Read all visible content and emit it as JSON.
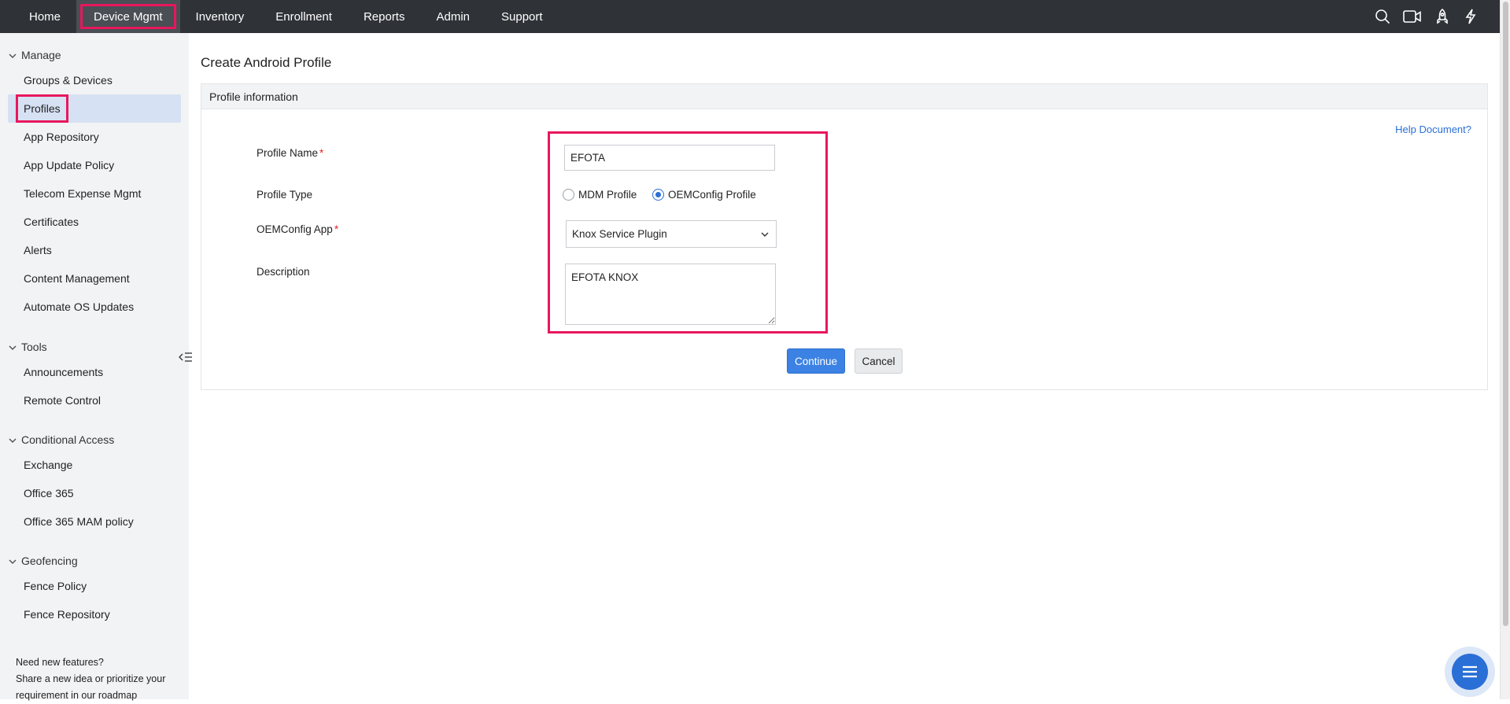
{
  "topnav": {
    "items": [
      {
        "label": "Home"
      },
      {
        "label": "Device Mgmt",
        "active": true
      },
      {
        "label": "Inventory"
      },
      {
        "label": "Enrollment"
      },
      {
        "label": "Reports"
      },
      {
        "label": "Admin"
      },
      {
        "label": "Support"
      }
    ],
    "icons": [
      "search-icon",
      "video-icon",
      "rocket-icon",
      "lightning-icon"
    ]
  },
  "sidebar": {
    "sections": {
      "manage": "Manage",
      "tools": "Tools",
      "conditional": "Conditional Access",
      "geofencing": "Geofencing"
    },
    "items": {
      "groups_devices": "Groups & Devices",
      "profiles": "Profiles",
      "app_repository": "App Repository",
      "app_update_policy": "App Update Policy",
      "telecom": "Telecom Expense Mgmt",
      "certificates": "Certificates",
      "alerts": "Alerts",
      "content_management": "Content Management",
      "automate_os": "Automate OS Updates",
      "announcements": "Announcements",
      "remote_control": "Remote Control",
      "exchange": "Exchange",
      "office365": "Office 365",
      "office365_mam": "Office 365 MAM policy",
      "fence_policy": "Fence Policy",
      "fence_repository": "Fence Repository"
    },
    "footer": {
      "line1": "Need new features?",
      "line2": "Share a new idea or prioritize your",
      "line3": "requirement in our roadmap"
    }
  },
  "main": {
    "title": "Create Android Profile",
    "panel_title": "Profile information",
    "help_link": "Help Document?",
    "form": {
      "profile_name_label": "Profile Name",
      "profile_name_value": "EFOTA",
      "profile_type_label": "Profile Type",
      "radio_mdm": "MDM Profile",
      "radio_oem": "OEMConfig Profile",
      "selected_type": "OEMConfig Profile",
      "oemconfig_label": "OEMConfig App",
      "oemconfig_value": "Knox Service Plugin",
      "description_label": "Description",
      "description_value": "EFOTA KNOX",
      "required_mark": "*"
    },
    "buttons": {
      "continue": "Continue",
      "cancel": "Cancel"
    }
  },
  "colors": {
    "topnav_bg": "#2f3237",
    "highlight": "#e8175d",
    "accent": "#2a6fd6",
    "primary_button": "#3b82e4",
    "sidebar_active": "#d6e1f3"
  }
}
